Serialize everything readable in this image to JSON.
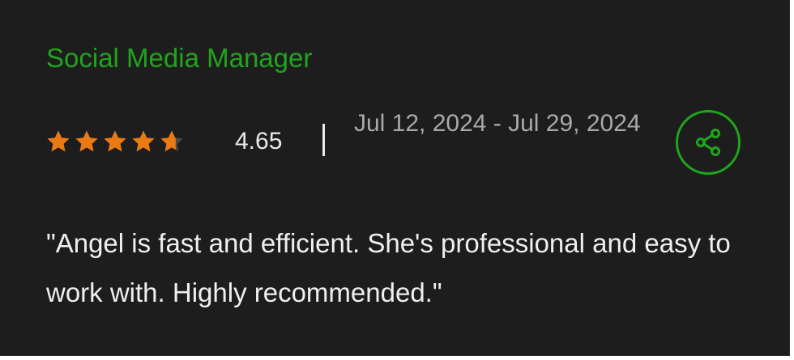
{
  "card": {
    "title": "Social Media Manager",
    "rating": {
      "value_label": "4.65",
      "value": 4.65,
      "max": 5,
      "star_fills": [
        1,
        1,
        1,
        1,
        0.65
      ],
      "star_color": "#ec7a13",
      "empty_star_color": "#4a4a4a"
    },
    "date_range": "Jul 12, 2024 - Jul 29, 2024",
    "share_icon": "share-icon",
    "review_text": "\"Angel is fast and efficient. She's professional and easy to work with. Highly recommended.\""
  },
  "colors": {
    "background": "#1d1d1d",
    "accent": "#1fa51c",
    "primary_text": "#efefef",
    "secondary_text": "#a9a9a9"
  }
}
